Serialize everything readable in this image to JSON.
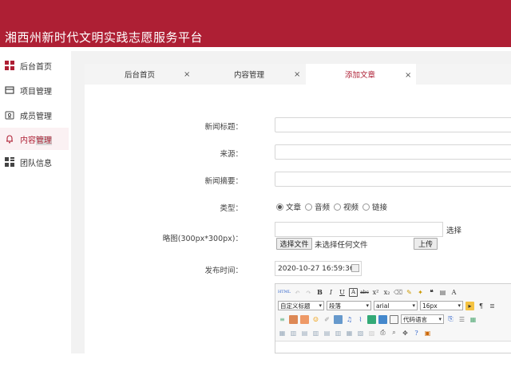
{
  "app": {
    "title": "湘西州新时代文明实践志愿服务平台"
  },
  "colors": {
    "brand": "#ae1f34",
    "active_bg": "#fbf1f3"
  },
  "sidebar": {
    "items": [
      {
        "label": "后台首页",
        "icon": "dashboard-grid-icon"
      },
      {
        "label": "项目管理",
        "icon": "folder-icon"
      },
      {
        "label": "成员管理",
        "icon": "member-card-icon"
      },
      {
        "label": "内容",
        "label_highlight": "管理",
        "icon": "bell-icon",
        "active": true
      },
      {
        "label": "团队信息",
        "icon": "team-grid-icon"
      }
    ]
  },
  "tabs": [
    {
      "label": "后台首页",
      "close": "×"
    },
    {
      "label": "内容管理",
      "close": "×"
    },
    {
      "label": "添加文章",
      "close": "×",
      "active": true
    }
  ],
  "form": {
    "title_label": "新闻标题：",
    "source_label": "来源：",
    "summary_label": "新闻摘要：",
    "type_label": "类型：",
    "type_options": [
      {
        "label": "文章",
        "checked": true
      },
      {
        "label": "音频",
        "checked": false
      },
      {
        "label": "视频",
        "checked": false
      },
      {
        "label": "链接",
        "checked": false
      }
    ],
    "thumb_label": "略图(300px*300px)：",
    "thumb_select_text": "选择",
    "file_button": "选择文件",
    "file_status": "未选择任何文件",
    "upload_button": "上传",
    "publish_label": "发布时间：",
    "publish_value": "2020-10-27 16:59:36"
  },
  "editor": {
    "heading_select": "自定义标题",
    "paragraph_select": "段落",
    "font_select": "arial",
    "size_select": "16px",
    "code_select": "代码语言"
  }
}
